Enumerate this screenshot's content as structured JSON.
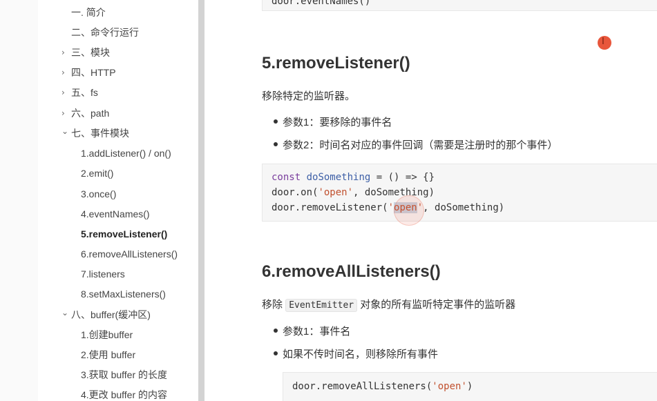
{
  "sidebar": {
    "items": [
      {
        "label": "一. 简介",
        "caret": ""
      },
      {
        "label": "二、命令行运行",
        "caret": ""
      },
      {
        "label": "三、模块",
        "caret": "›"
      },
      {
        "label": "四、HTTP",
        "caret": "›"
      },
      {
        "label": "五、fs",
        "caret": "›"
      },
      {
        "label": "六、path",
        "caret": "›"
      },
      {
        "label": "七、事件模块",
        "caret": "⌄"
      },
      {
        "label": "1.addListener() / on()",
        "caret": ""
      },
      {
        "label": "2.emit()",
        "caret": ""
      },
      {
        "label": "3.once()",
        "caret": ""
      },
      {
        "label": "4.eventNames()",
        "caret": ""
      },
      {
        "label": "5.removeListener()",
        "caret": ""
      },
      {
        "label": "6.removeAllListeners()",
        "caret": ""
      },
      {
        "label": "7.listeners",
        "caret": ""
      },
      {
        "label": "8.setMaxListeners()",
        "caret": ""
      },
      {
        "label": "八、buffer(缓冲区)",
        "caret": "⌄"
      },
      {
        "label": "1.创建buffer",
        "caret": ""
      },
      {
        "label": "2.使用 buffer",
        "caret": ""
      },
      {
        "label": "3.获取 buffer 的长度",
        "caret": ""
      },
      {
        "label": "4.更改 buffer 的内容",
        "caret": ""
      }
    ]
  },
  "content": {
    "top_code": "door.eventNames()",
    "section5": {
      "heading": "5.removeListener()",
      "description": "移除特定的监听器。",
      "bullets": [
        "参数1：要移除的事件名",
        "参数2：时间名对应的事件回调（需要是注册时的那个事件）"
      ],
      "code": {
        "line1_kw": "const",
        "line1_name": "doSomething",
        "line1_rest": " = () => {}",
        "line2_pre": "door.on(",
        "line2_str": "'open'",
        "line2_post": ", doSomething)",
        "line3_pre": "door.removeListener(",
        "line3_q1": "'",
        "line3_sel": "open",
        "line3_q2": "'",
        "line3_post": ", doSomething)"
      }
    },
    "section6": {
      "heading": "6.removeAllListeners()",
      "desc_pre": "移除",
      "desc_code": "EventEmitter",
      "desc_post": "对象的所有监听特定事件的监听器",
      "bullets": [
        "参数1：事件名",
        "如果不传时间名，则移除所有事件"
      ],
      "code_pre": "door.removeAllListeners(",
      "code_str": "'open'",
      "code_post": ")"
    }
  },
  "cursor": {
    "glyph": "I"
  }
}
